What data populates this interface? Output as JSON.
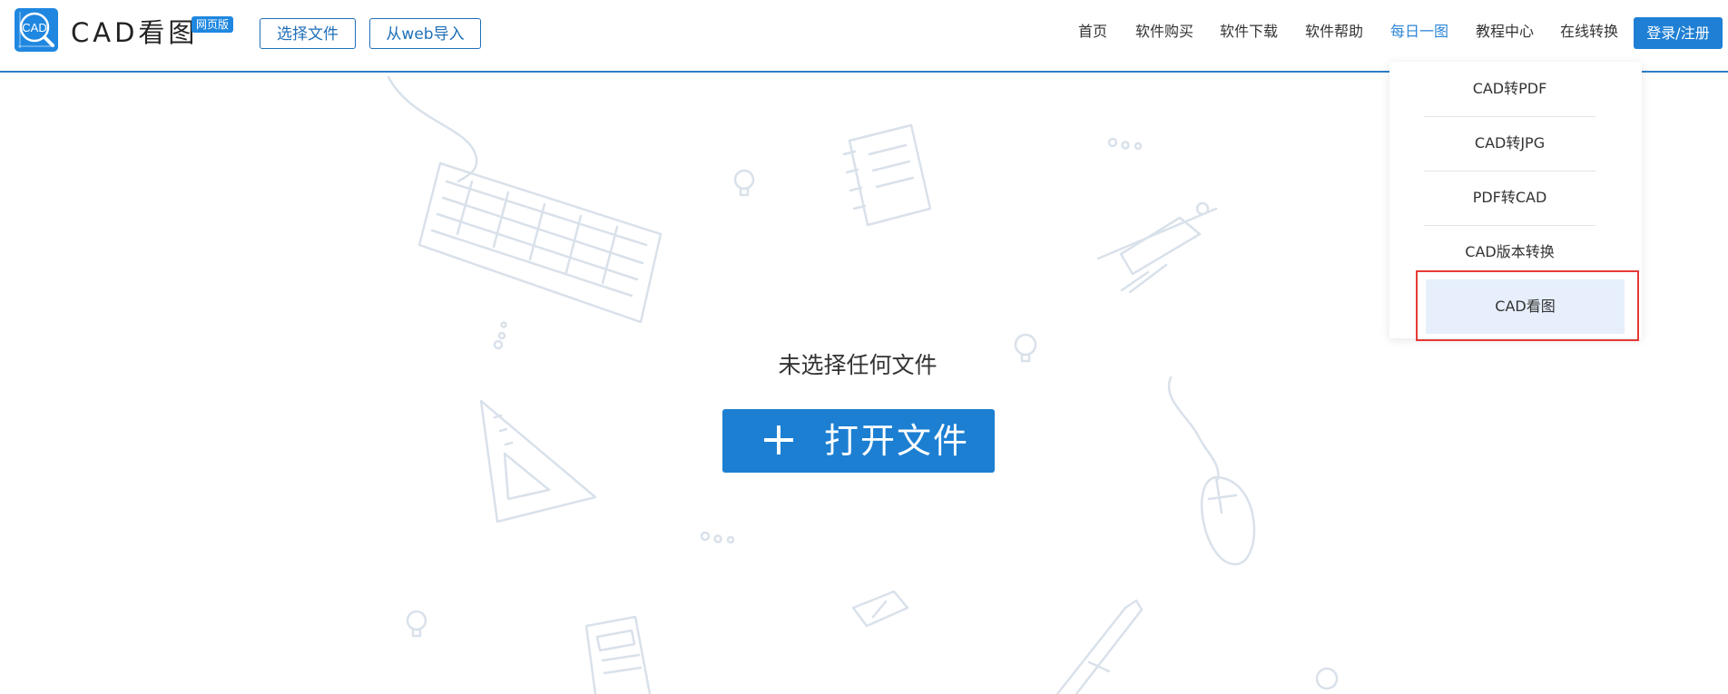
{
  "brand": {
    "name": "CAD看图",
    "badge": "网页版",
    "logo_text": "CAD"
  },
  "header": {
    "select_file": "选择文件",
    "web_import": "从web导入",
    "nav": [
      "首页",
      "软件购买",
      "软件下载",
      "软件帮助",
      "每日一图",
      "教程中心",
      "在线转换"
    ],
    "active_nav": "每日一图",
    "login": "登录/注册"
  },
  "dropdown": {
    "items": [
      "CAD转PDF",
      "CAD转JPG",
      "PDF转CAD",
      "CAD版本转换",
      "CAD看图"
    ],
    "highlighted": "CAD看图"
  },
  "main": {
    "message": "未选择任何文件",
    "open_button": "打开文件"
  },
  "colors": {
    "accent": "#1f87e0",
    "button_blue": "#1c7fd2",
    "header_line": "#2e7fc9",
    "active_nav": "#2e86d6",
    "highlight_bg": "#e6effb",
    "annotation_red": "#e53935",
    "doodle": "#d9e1ea"
  },
  "icons": {
    "logo": "cad-magnifier-logo-icon",
    "open": "plus-icon",
    "doodles": [
      "keyboard-icon",
      "notebook-icon",
      "lightbulb-icon",
      "compass-icon",
      "triangle-ruler-icon",
      "mouse-icon",
      "eraser-icon",
      "pencil-icon",
      "calculator-icon"
    ]
  }
}
